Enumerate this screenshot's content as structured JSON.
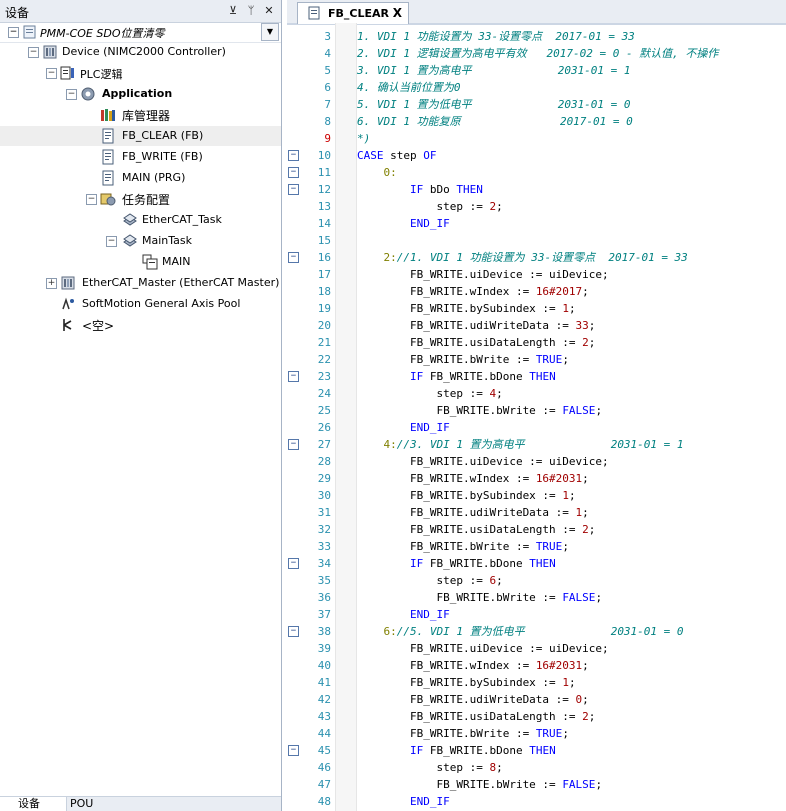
{
  "left_panel": {
    "title": "设备",
    "pin_glyph": "⊻",
    "pin2_glyph": "ᛘ",
    "close_glyph": "✕",
    "project_name": "PMM-COE SDO位置清零",
    "tree": [
      {
        "label": "Device (NIMC2000 Controller)",
        "icon": "plc-device-icon",
        "expander": "⊟"
      },
      {
        "label": "PLC逻辑",
        "icon": "plc-logic-icon",
        "expander": "⊟"
      },
      {
        "label": "Application",
        "icon": "application-gear-icon",
        "expander": "⊟"
      },
      {
        "label": "库管理器",
        "icon": "library-manager-icon"
      },
      {
        "label": "FB_CLEAR (FB)",
        "icon": "function-block-icon"
      },
      {
        "label": "FB_WRITE (FB)",
        "icon": "function-block-icon"
      },
      {
        "label": "MAIN (PRG)",
        "icon": "program-icon"
      },
      {
        "label": "任务配置",
        "icon": "task-config-icon",
        "expander": "⊟"
      },
      {
        "label": "EtherCAT_Task",
        "icon": "task-icon"
      },
      {
        "label": "MainTask",
        "icon": "task-icon",
        "expander": "⊟"
      },
      {
        "label": "MAIN",
        "icon": "program-call-icon"
      },
      {
        "label": "EtherCAT_Master (EtherCAT Master)",
        "icon": "ethercat-master-icon",
        "expander": "⊞"
      },
      {
        "label": "SoftMotion General Axis Pool",
        "icon": "axis-pool-icon"
      },
      {
        "label": "<空>",
        "icon": "empty-slot-icon"
      }
    ],
    "bottom_tabs": [
      {
        "label": "设备"
      },
      {
        "label": "POU"
      }
    ]
  },
  "editor": {
    "tab_label": "FB_CLEAR",
    "tab_close": "X",
    "fold_glyph": "⊟",
    "lines": [
      {
        "n": "3",
        "text": "1. VDI 1 功能设置为 33-设置零点  2017-01 = 33",
        "kind": "cm"
      },
      {
        "n": "4",
        "text": "2. VDI 1 逻辑设置为高电平有效   2017-02 = 0 - 默认值, 不操作",
        "kind": "cm"
      },
      {
        "n": "5",
        "text": "3. VDI 1 置为高电平             2031-01 = 1",
        "kind": "cm"
      },
      {
        "n": "6",
        "text": "4. 确认当前位置为0",
        "kind": "cm"
      },
      {
        "n": "7",
        "text": "5. VDI 1 置为低电平             2031-01 = 0",
        "kind": "cm"
      },
      {
        "n": "8",
        "text": "6. VDI 1 功能复原               2017-01 = 0",
        "kind": "cm"
      },
      {
        "n": "9",
        "text": "*)",
        "kind": "cm",
        "err": true
      },
      {
        "n": "10",
        "text": "CASE step OF",
        "fold": true
      },
      {
        "n": "11",
        "text": "    0:",
        "fold": true
      },
      {
        "n": "12",
        "text": "        IF bDo THEN",
        "fold": true
      },
      {
        "n": "13",
        "text": "            step := 2;"
      },
      {
        "n": "14",
        "text": "        END_IF"
      },
      {
        "n": "15",
        "text": ""
      },
      {
        "n": "16",
        "text": "    2://1. VDI 1 功能设置为 33-设置零点  2017-01 = 33",
        "fold": true
      },
      {
        "n": "17",
        "text": "        FB_WRITE.uiDevice := uiDevice;"
      },
      {
        "n": "18",
        "text": "        FB_WRITE.wIndex := 16#2017;"
      },
      {
        "n": "19",
        "text": "        FB_WRITE.bySubindex := 1;"
      },
      {
        "n": "20",
        "text": "        FB_WRITE.udiWriteData := 33;"
      },
      {
        "n": "21",
        "text": "        FB_WRITE.usiDataLength := 2;"
      },
      {
        "n": "22",
        "text": "        FB_WRITE.bWrite := TRUE;"
      },
      {
        "n": "23",
        "text": "        IF FB_WRITE.bDone THEN",
        "fold": true
      },
      {
        "n": "24",
        "text": "            step := 4;"
      },
      {
        "n": "25",
        "text": "            FB_WRITE.bWrite := FALSE;"
      },
      {
        "n": "26",
        "text": "        END_IF"
      },
      {
        "n": "27",
        "text": "    4://3. VDI 1 置为高电平             2031-01 = 1",
        "fold": true
      },
      {
        "n": "28",
        "text": "        FB_WRITE.uiDevice := uiDevice;"
      },
      {
        "n": "29",
        "text": "        FB_WRITE.wIndex := 16#2031;"
      },
      {
        "n": "30",
        "text": "        FB_WRITE.bySubindex := 1;"
      },
      {
        "n": "31",
        "text": "        FB_WRITE.udiWriteData := 1;"
      },
      {
        "n": "32",
        "text": "        FB_WRITE.usiDataLength := 2;"
      },
      {
        "n": "33",
        "text": "        FB_WRITE.bWrite := TRUE;"
      },
      {
        "n": "34",
        "text": "        IF FB_WRITE.bDone THEN",
        "fold": true
      },
      {
        "n": "35",
        "text": "            step := 6;"
      },
      {
        "n": "36",
        "text": "            FB_WRITE.bWrite := FALSE;"
      },
      {
        "n": "37",
        "text": "        END_IF"
      },
      {
        "n": "38",
        "text": "    6://5. VDI 1 置为低电平             2031-01 = 0",
        "fold": true
      },
      {
        "n": "39",
        "text": "        FB_WRITE.uiDevice := uiDevice;"
      },
      {
        "n": "40",
        "text": "        FB_WRITE.wIndex := 16#2031;"
      },
      {
        "n": "41",
        "text": "        FB_WRITE.bySubindex := 1;"
      },
      {
        "n": "42",
        "text": "        FB_WRITE.udiWriteData := 0;"
      },
      {
        "n": "43",
        "text": "        FB_WRITE.usiDataLength := 2;"
      },
      {
        "n": "44",
        "text": "        FB_WRITE.bWrite := TRUE;"
      },
      {
        "n": "45",
        "text": "        IF FB_WRITE.bDone THEN",
        "fold": true
      },
      {
        "n": "46",
        "text": "            step := 8;"
      },
      {
        "n": "47",
        "text": "            FB_WRITE.bWrite := FALSE;"
      },
      {
        "n": "48",
        "text": "        END_IF"
      }
    ]
  }
}
